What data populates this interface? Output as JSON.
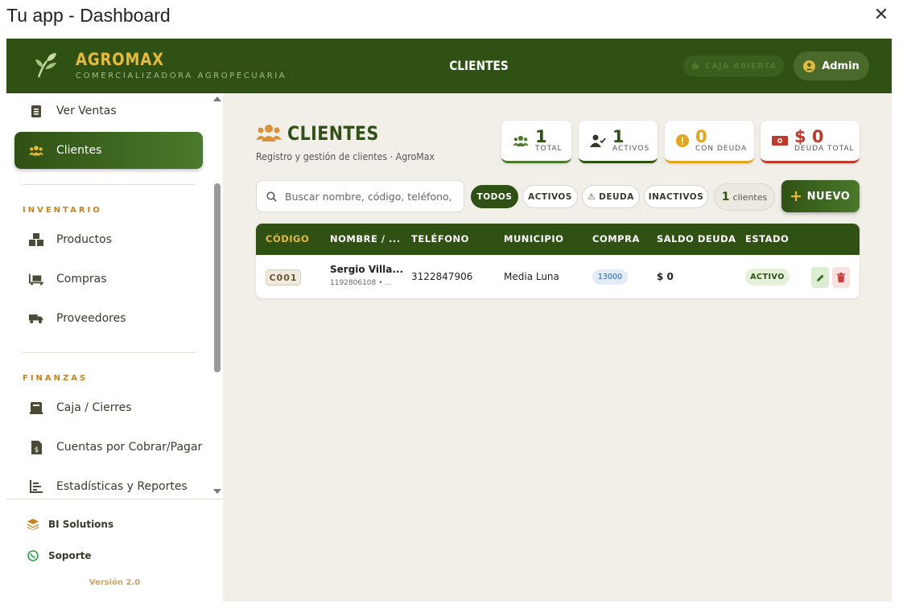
{
  "window": {
    "title": "Tu app - Dashboard",
    "close_glyph": "✕"
  },
  "brand": {
    "name": "AGROMAX",
    "subtitle": "COMERCIALIZADORA AGROPECUARIA"
  },
  "topbar": {
    "section_title": "CLIENTES",
    "caja_label": "CAJA ABIERTA",
    "user_label": "Admin"
  },
  "sidebar": {
    "items": [
      {
        "label": "Ver Ventas",
        "icon": "receipt-icon"
      },
      {
        "label": "Clientes",
        "icon": "users-icon",
        "active": true
      }
    ],
    "inventario": {
      "title": "INVENTARIO",
      "items": [
        {
          "label": "Productos",
          "icon": "boxes-icon"
        },
        {
          "label": "Compras",
          "icon": "dolly-icon"
        },
        {
          "label": "Proveedores",
          "icon": "truck-icon"
        }
      ]
    },
    "finanzas": {
      "title": "FINANZAS",
      "items": [
        {
          "label": "Caja / Cierres",
          "icon": "cash-register-icon"
        },
        {
          "label": "Cuentas por Cobrar/Pagar",
          "icon": "invoice-dollar-icon"
        },
        {
          "label": "Estadísticas y Reportes",
          "icon": "chart-icon"
        }
      ]
    },
    "footer": {
      "bi_label": "BI Solutions",
      "support_label": "Soporte",
      "version": "Versión 2.0"
    }
  },
  "page": {
    "title": "CLIENTES",
    "subtitle": "Registro y gestión de clientes · AgroMax"
  },
  "stats": [
    {
      "value": "1",
      "label": "TOTAL",
      "color": "#4a7a2a"
    },
    {
      "value": "1",
      "label": "ACTIVOS",
      "color": "#2f5114"
    },
    {
      "value": "0",
      "label": "CON DEUDA",
      "color": "#e8a317"
    },
    {
      "value": "$ 0",
      "label": "DEUDA TOTAL",
      "color": "#c0392b"
    }
  ],
  "filters": {
    "search_placeholder": "Buscar nombre, código, teléfono, m",
    "chips": [
      "TODOS",
      "ACTIVOS",
      "⚠ DEUDA",
      "INACTIVOS"
    ],
    "count_value": "1",
    "count_label": "clientes",
    "new_label": "NUEVO"
  },
  "table": {
    "headers": [
      "CÓDIGO",
      "NOMBRE / ...",
      "TELÉFONO",
      "MUNICIPIO",
      "COMPRA",
      "SALDO DEUDA",
      "ESTADO"
    ],
    "rows": [
      {
        "code": "C001",
        "name": "Sergio Villa...",
        "id_line": "1192806108 • ...",
        "phone": "3122847906",
        "municipio": "Media Luna",
        "compra": "13000",
        "saldo": "$ 0",
        "estado": "ACTIVO"
      }
    ]
  },
  "colors": {
    "primary": "#2f5114",
    "accent": "#e8b93a",
    "background": "#f1efe8",
    "danger": "#c0392b",
    "warning": "#e8a317"
  }
}
